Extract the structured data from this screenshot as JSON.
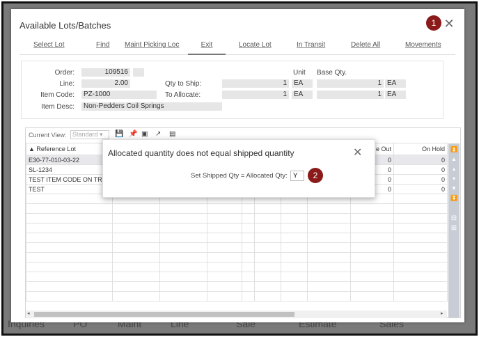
{
  "background": {
    "texts": [
      "Inquiries",
      "PO",
      "Maint",
      "Line",
      "Sale",
      "Estimate",
      "Sales"
    ]
  },
  "dialog": {
    "title": "Available Lots/Batches",
    "close_icon": "close-icon",
    "badges": [
      "1",
      "2"
    ],
    "tabs": [
      "Select Lot",
      "Find",
      "Maint Picking Loc",
      "Exit",
      "Locate Lot",
      "In Transit",
      "Delete All",
      "Movements"
    ],
    "active_tab": "Exit"
  },
  "info": {
    "order_label": "Order:",
    "order_value": "109516",
    "line_label": "Line:",
    "line_value": "2.00",
    "item_code_label": "Item Code:",
    "item_code_value": "PZ-1000",
    "item_desc_label": "Item Desc:",
    "item_desc_value": "Non-Pedders Coil Springs",
    "qty_to_ship_label": "Qty to Ship:",
    "qty_to_ship_value": "1",
    "qty_to_ship_unit": "EA",
    "to_allocate_label": "To Allocate:",
    "to_allocate_value": "1",
    "to_allocate_unit": "EA",
    "unit_header": "Unit",
    "base_qty_header": "Base Qty.",
    "base_qty_ship_value": "1",
    "base_qty_ship_unit": "EA",
    "base_qty_alloc_value": "1",
    "base_qty_alloc_unit": "EA"
  },
  "grid": {
    "current_view_label": "Current View:",
    "current_view_value": "Standard",
    "columns": {
      "reference_lot": "▲ Reference Lot",
      "issue_out": "e Out",
      "on_hold": "On Hold"
    },
    "rows": [
      {
        "ref": "E30-77-010-03-22",
        "issue_out": "0",
        "on_hold": "0"
      },
      {
        "ref": "SL-1234",
        "issue_out": "0",
        "on_hold": "0"
      },
      {
        "ref": "TEST ITEM CODE ON TR",
        "issue_out": "0",
        "on_hold": "0"
      },
      {
        "ref": "TEST",
        "issue_out": "0",
        "on_hold": "0"
      }
    ]
  },
  "modal": {
    "title": "Allocated quantity does not equal shipped quantity",
    "prompt": "Set Shipped Qty = Allocated Qty:",
    "input_value": "Y"
  }
}
